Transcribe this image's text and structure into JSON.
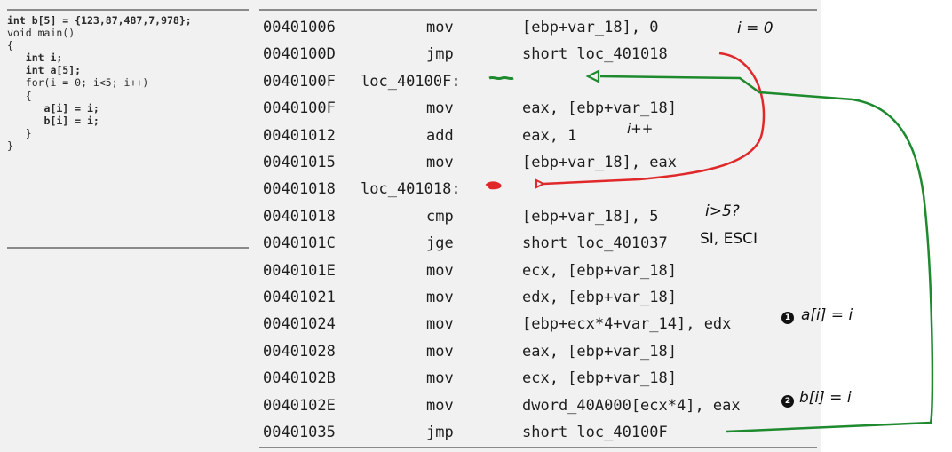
{
  "source_code": {
    "lines": [
      "int b[5] = {123,87,487,7,978};",
      "void main()",
      "{",
      "   int i;",
      "   int a[5];",
      "",
      "   for(i = 0; i<5; i++)",
      "   {",
      "      a[i] = i;",
      "      b[i] = i;",
      "   }",
      "}"
    ]
  },
  "disassembly": {
    "rows": [
      {
        "addr": "00401006",
        "label": "",
        "mnemonic": "mov",
        "operands": "[ebp+var_18], 0"
      },
      {
        "addr": "0040100D",
        "label": "",
        "mnemonic": "jmp",
        "operands": "short loc_401018"
      },
      {
        "addr": "0040100F",
        "label": "loc_40100F:",
        "mnemonic": "",
        "operands": ""
      },
      {
        "addr": "0040100F",
        "label": "",
        "mnemonic": "mov",
        "operands": "eax, [ebp+var_18]"
      },
      {
        "addr": "00401012",
        "label": "",
        "mnemonic": "add",
        "operands": "eax, 1"
      },
      {
        "addr": "00401015",
        "label": "",
        "mnemonic": "mov",
        "operands": "[ebp+var_18], eax"
      },
      {
        "addr": "00401018",
        "label": "loc_401018:",
        "mnemonic": "",
        "operands": ""
      },
      {
        "addr": "00401018",
        "label": "",
        "mnemonic": "cmp",
        "operands": "[ebp+var_18], 5"
      },
      {
        "addr": "0040101C",
        "label": "",
        "mnemonic": "jge",
        "operands": "short loc_401037"
      },
      {
        "addr": "0040101E",
        "label": "",
        "mnemonic": "mov",
        "operands": "ecx, [ebp+var_18]"
      },
      {
        "addr": "00401021",
        "label": "",
        "mnemonic": "mov",
        "operands": "edx, [ebp+var_18]"
      },
      {
        "addr": "00401024",
        "label": "",
        "mnemonic": "mov",
        "operands": "[ebp+ecx*4+var_14], edx"
      },
      {
        "addr": "00401028",
        "label": "",
        "mnemonic": "mov",
        "operands": "eax, [ebp+var_18]"
      },
      {
        "addr": "0040102B",
        "label": "",
        "mnemonic": "mov",
        "operands": "ecx, [ebp+var_18]"
      },
      {
        "addr": "0040102E",
        "label": "",
        "mnemonic": "mov",
        "operands": "dword_40A000[ecx*4], eax"
      },
      {
        "addr": "00401035",
        "label": "",
        "mnemonic": "jmp",
        "operands": "short loc_40100F"
      }
    ]
  },
  "annotations": {
    "i_init": "i = 0",
    "i_incr": "i++",
    "compare": "i>5?",
    "exit": "SI, ESCI",
    "badge_1": "1",
    "assign_a": "a[i] = i",
    "badge_2": "2",
    "assign_b": "b[i] = i"
  },
  "colors": {
    "panel_bg": "#f1f1f1",
    "rule": "#8a8a8a",
    "red_arrow": "#e0282a",
    "green_arrow": "#1e8a2e",
    "ink": "#111111"
  }
}
